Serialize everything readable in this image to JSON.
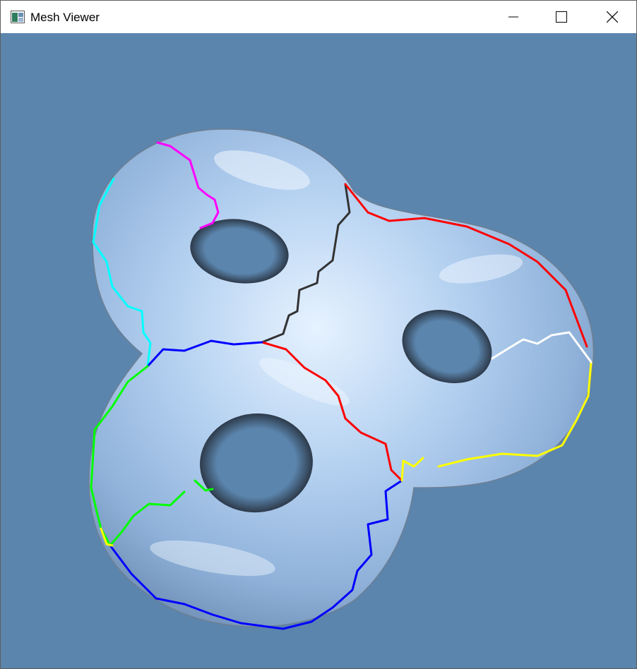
{
  "window": {
    "title": "Mesh Viewer",
    "icon": "mesh-viewer-app-icon",
    "controls": [
      "minimize-icon",
      "maximize-icon",
      "close-icon"
    ]
  },
  "viewport": {
    "background_color": "#5b85ad",
    "mesh_color": "#a9c7eb",
    "mesh_description_hidden": true,
    "seam_colors": [
      "#ff00ff",
      "#00ffff",
      "#333333",
      "#ff0000",
      "#0000ff",
      "#00ff00",
      "#ffff00",
      "#ffffff"
    ]
  }
}
